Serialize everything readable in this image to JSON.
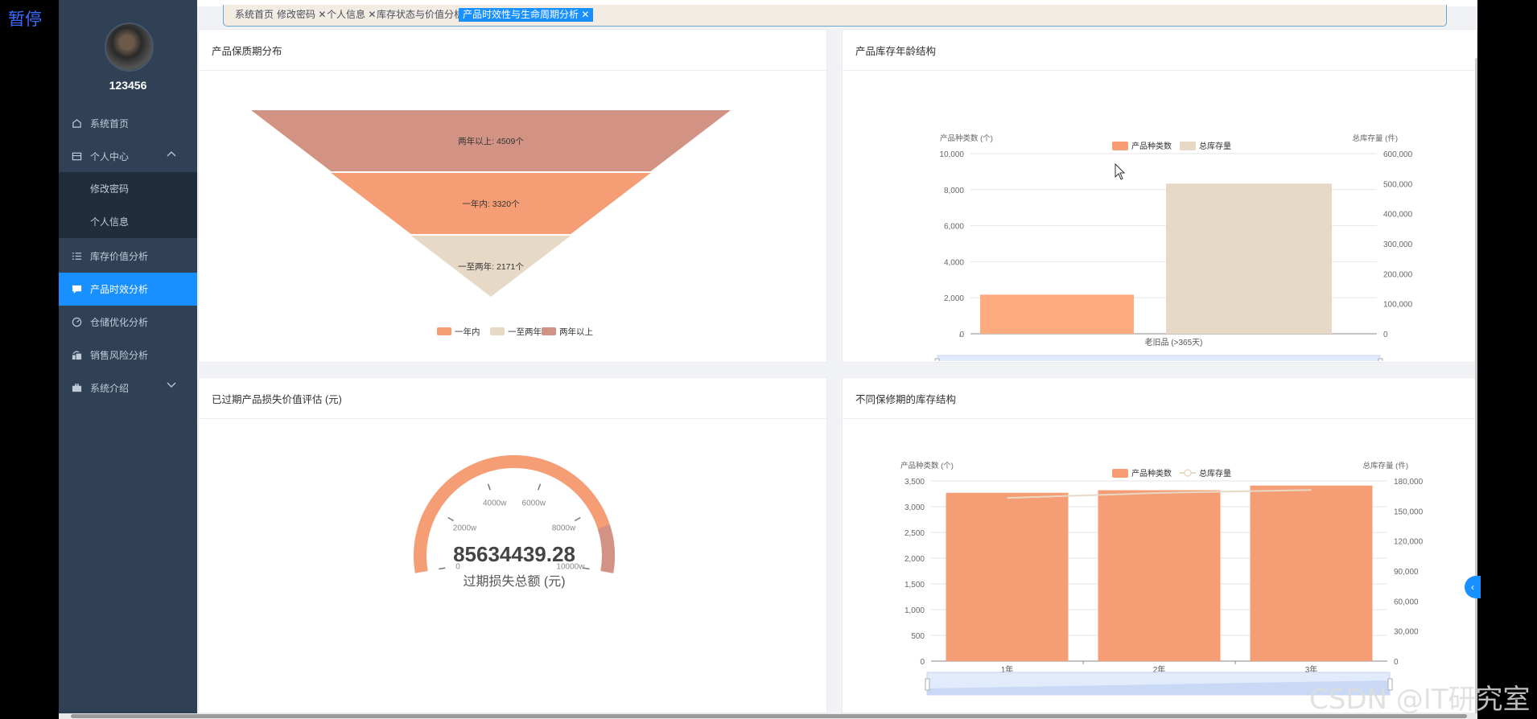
{
  "overlay": {
    "pause_text": "暂停",
    "watermark": "CSDN @IT研究室"
  },
  "user": {
    "name": "123456"
  },
  "sidebar": {
    "items": [
      {
        "label": "系统首页",
        "icon": "home-icon"
      },
      {
        "label": "个人中心",
        "icon": "profile-card-icon"
      },
      {
        "label": "修改密码"
      },
      {
        "label": "个人信息"
      },
      {
        "label": "库存价值分析",
        "icon": "list-icon"
      },
      {
        "label": "产品时效分析",
        "icon": "chat-icon"
      },
      {
        "label": "仓储优化分析",
        "icon": "gauge-icon"
      },
      {
        "label": "销售风险分析",
        "icon": "trend-icon"
      },
      {
        "label": "系统介绍",
        "icon": "briefcase-icon"
      }
    ],
    "active_item": "产品时效分析"
  },
  "tabs": [
    {
      "label": "系统首页"
    },
    {
      "label": "修改密码"
    },
    {
      "label": "个人信息"
    },
    {
      "label": "库存状态与价值分析"
    },
    {
      "label": "产品时效性与生命周期分析",
      "active": true
    }
  ],
  "cards": {
    "shelf_life": {
      "title": "产品保质期分布"
    },
    "age_structure": {
      "title": "产品库存年龄结构"
    },
    "expired_loss": {
      "title": "已过期产品损失价值评估 (元)"
    },
    "warranty_structure": {
      "title": "不同保修期的库存结构"
    }
  },
  "colors": {
    "orange": "#f59d75",
    "beige": "#e6d9c5",
    "brown": "#d29384",
    "accent": "#1890ff",
    "sidebar": "#304156"
  },
  "chart_data": [
    {
      "type": "funnel",
      "categories": [
        "两年以上",
        "一年内",
        "一至两年"
      ],
      "values": [
        4509,
        3320,
        2171
      ],
      "labels": [
        "两年以上: 4509个",
        "一年内: 3320个",
        "一至两年: 2171个"
      ],
      "legend": [
        "一年内",
        "一至两年",
        "两年以上"
      ],
      "legend_position": "bottom"
    },
    {
      "type": "bar",
      "categories": [
        "老旧品 (>365天)"
      ],
      "series": [
        {
          "name": "产品种类数",
          "values": [
            2171
          ],
          "axis": "left"
        },
        {
          "name": "总库存量",
          "values": [
            500000
          ],
          "axis": "right"
        }
      ],
      "ylabel": "产品种类数 (个)",
      "y2label": "总库存量 (件)",
      "ylim": [
        0,
        10000
      ],
      "y2lim": [
        0,
        600000
      ],
      "yticks": [
        "0",
        "2,000",
        "4,000",
        "6,000",
        "8,000",
        "10,000"
      ],
      "y2ticks": [
        "0",
        "100,000",
        "200,000",
        "300,000",
        "400,000",
        "500,000",
        "600,000"
      ],
      "legend_position": "top"
    },
    {
      "type": "gauge",
      "value": 85634439.28,
      "value_text": "85634439.28",
      "label": "过期损失总额 (元)",
      "range": [
        0,
        10000
      ],
      "ticks": [
        "0",
        "2000w",
        "4000w",
        "6000w",
        "8000w",
        "10000w"
      ]
    },
    {
      "type": "bar",
      "categories": [
        "1年",
        "2年",
        "3年"
      ],
      "series": [
        {
          "name": "产品种类数",
          "type": "bar",
          "values": [
            3270,
            3320,
            3410
          ],
          "axis": "left"
        },
        {
          "name": "总库存量",
          "type": "line",
          "values": [
            163000,
            168000,
            171000
          ],
          "axis": "right"
        }
      ],
      "ylabel": "产品种类数 (个)",
      "y2label": "总库存量 (件)",
      "ylim": [
        0,
        3500
      ],
      "y2lim": [
        0,
        180000
      ],
      "yticks": [
        "0",
        "500",
        "1,000",
        "1,500",
        "2,000",
        "2,500",
        "3,000",
        "3,500"
      ],
      "y2ticks": [
        "0",
        "30,000",
        "60,000",
        "90,000",
        "120,000",
        "150,000",
        "180,000"
      ],
      "legend_position": "top"
    }
  ]
}
